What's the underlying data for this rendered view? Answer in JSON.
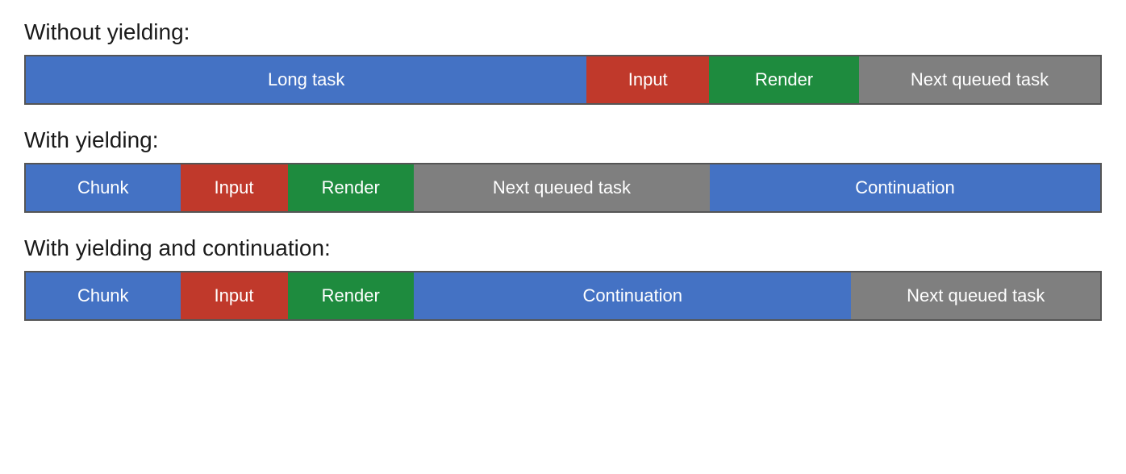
{
  "diagram": {
    "section1": {
      "title": "Without yielding:",
      "segments": [
        {
          "label": "Long task",
          "class": "seg-blue r1-longtask"
        },
        {
          "label": "Input",
          "class": "seg-red  r1-input"
        },
        {
          "label": "Render",
          "class": "seg-green r1-render"
        },
        {
          "label": "Next queued task",
          "class": "seg-gray r1-next"
        }
      ]
    },
    "section2": {
      "title": "With yielding:",
      "segments": [
        {
          "label": "Chunk",
          "class": "seg-blue r2-chunk"
        },
        {
          "label": "Input",
          "class": "seg-red  r2-input"
        },
        {
          "label": "Render",
          "class": "seg-green r2-render"
        },
        {
          "label": "Next queued task",
          "class": "seg-gray r2-next"
        },
        {
          "label": "Continuation",
          "class": "seg-blue r2-cont"
        }
      ]
    },
    "section3": {
      "title": "With yielding and continuation:",
      "segments": [
        {
          "label": "Chunk",
          "class": "seg-blue r3-chunk"
        },
        {
          "label": "Input",
          "class": "seg-red  r3-input"
        },
        {
          "label": "Render",
          "class": "seg-green r3-render"
        },
        {
          "label": "Continuation",
          "class": "seg-blue r3-cont"
        },
        {
          "label": "Next queued task",
          "class": "seg-gray r3-next"
        }
      ]
    }
  }
}
